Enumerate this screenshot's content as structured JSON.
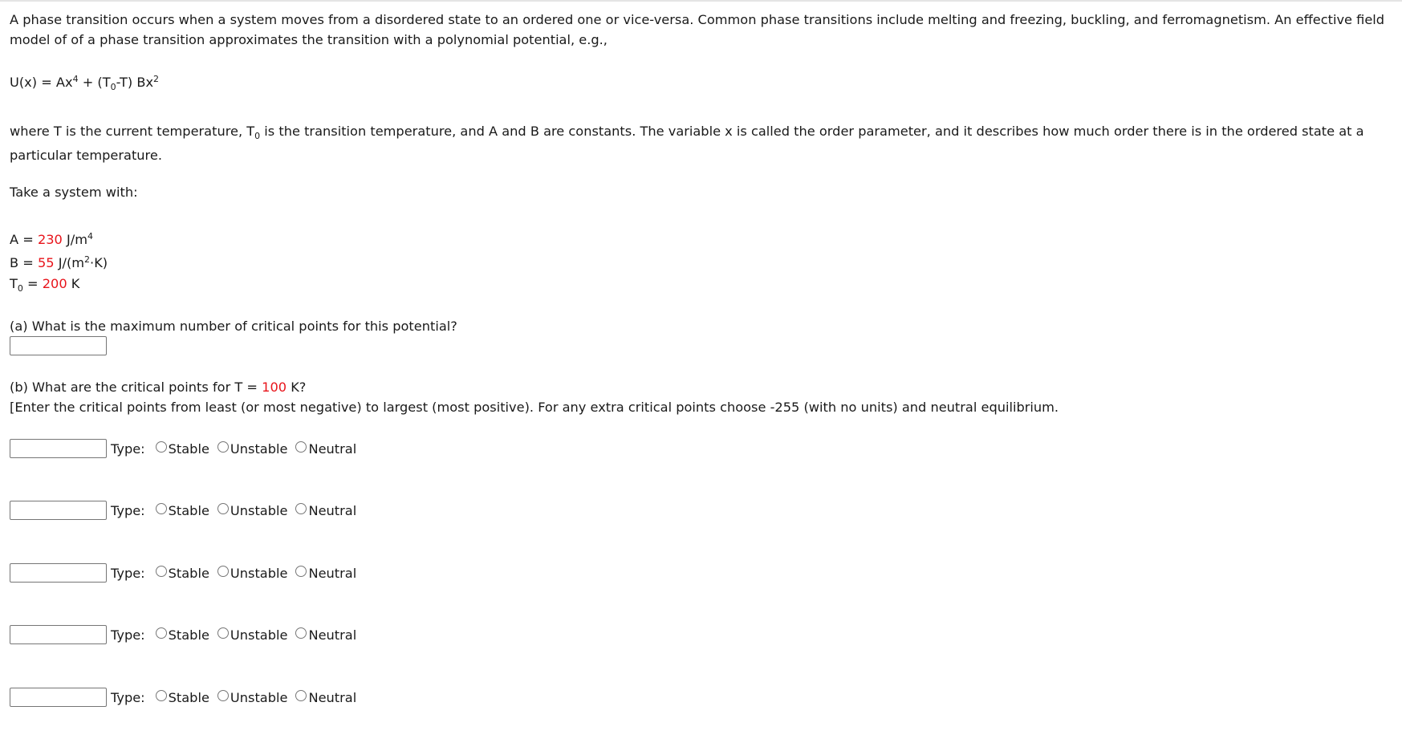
{
  "intro": {
    "text": "A phase transition occurs when a system moves from a disordered state to an ordered one or vice-versa. Common phase transitions include melting and freezing, buckling, and ferromagnetism. An effective field model of of a phase transition approximates the transition with a polynomial potential, e.g.,"
  },
  "equation": {
    "lhs": "U(x) = Ax",
    "exp1": "4",
    "mid": " + (T",
    "sub0": "0",
    "mid2": "-T) Bx",
    "exp2": "2"
  },
  "where": {
    "part1": "where T is the current temperature, T",
    "sub0": "0",
    "part2": " is the transition temperature, and A and B are constants. The variable x is called the order parameter, and it describes how much order there is in the ordered state at a particular temperature."
  },
  "take_system": "Take a system with:",
  "params": {
    "A": {
      "label": "A = ",
      "value": "230",
      "unit": " J/m",
      "unit_exp": "4",
      "unit_tail": ""
    },
    "B": {
      "label": "B = ",
      "value": "55",
      "unit": " J/(m",
      "unit_exp": "2",
      "unit_tail": "·K)"
    },
    "T0": {
      "label_main": "T",
      "label_sub": "0",
      "label_eq": " = ",
      "value": "200",
      "unit": " K"
    }
  },
  "question_a": {
    "text": "(a) What is the maximum number of critical points for this potential?",
    "answer_value": ""
  },
  "question_b": {
    "text_pre": "(b) What are the critical points for T = ",
    "temperature": "100",
    "text_post": " K?",
    "instructions": "[Enter the critical points from least (or most negative) to largest (most positive). For any extra critical points choose -255 (with no units) and neutral equilibrium."
  },
  "critical_points": [
    {
      "value": "",
      "type_label": "Type:",
      "options": [
        "Stable",
        "Unstable",
        "Neutral"
      ],
      "selected": null
    },
    {
      "value": "",
      "type_label": "Type:",
      "options": [
        "Stable",
        "Unstable",
        "Neutral"
      ],
      "selected": null
    },
    {
      "value": "",
      "type_label": "Type:",
      "options": [
        "Stable",
        "Unstable",
        "Neutral"
      ],
      "selected": null
    },
    {
      "value": "",
      "type_label": "Type:",
      "options": [
        "Stable",
        "Unstable",
        "Neutral"
      ],
      "selected": null
    },
    {
      "value": "",
      "type_label": "Type:",
      "options": [
        "Stable",
        "Unstable",
        "Neutral"
      ],
      "selected": null
    }
  ],
  "colors": {
    "highlight_value": "#e8141b",
    "text": "#1a1a1a",
    "input_border": "#767676"
  }
}
